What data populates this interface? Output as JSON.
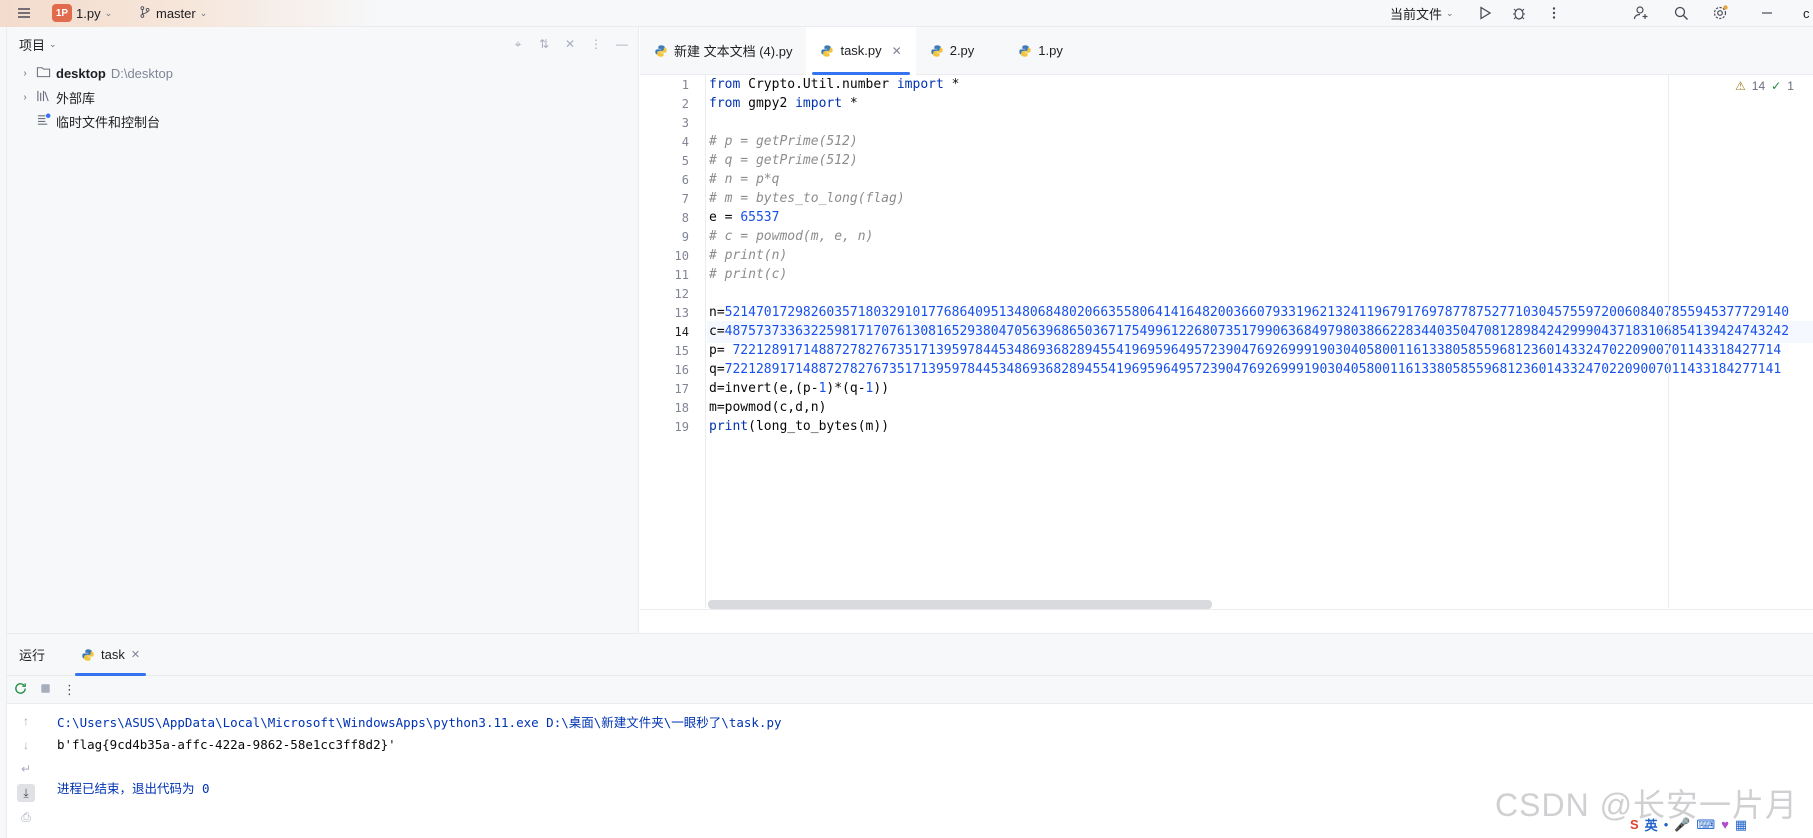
{
  "titlebar": {
    "project_badge": "1P",
    "project_name": "1.py",
    "branch": "master",
    "run_config": "当前文件",
    "overflow_label": "c"
  },
  "project_panel": {
    "title": "项目",
    "tree": [
      {
        "label": "desktop",
        "path": "D:\\desktop"
      },
      {
        "label": "外部库"
      },
      {
        "label": "临时文件和控制台"
      }
    ]
  },
  "editor": {
    "tabs": [
      {
        "label": "新建 文本文档 (4).py",
        "active": false
      },
      {
        "label": "task.py",
        "active": true
      },
      {
        "label": "2.py",
        "active": false
      },
      {
        "label": "1.py",
        "active": false
      }
    ],
    "inspections": {
      "warnings": "14",
      "checks": "1"
    },
    "current_line": 14,
    "line_numbers": [
      "1",
      "2",
      "3",
      "4",
      "5",
      "6",
      "7",
      "8",
      "9",
      "10",
      "11",
      "12",
      "13",
      "14",
      "15",
      "16",
      "17",
      "18",
      "19"
    ],
    "lines": [
      {
        "k1": "from",
        "t1": " Crypto.Util.number ",
        "k2": "import",
        "t2": " *"
      },
      {
        "k1": "from",
        "t1": " gmpy2 ",
        "k2": "import",
        "t2": " *"
      },
      {
        "t": ""
      },
      {
        "c": "# p = getPrime(512)"
      },
      {
        "c": "# q = getPrime(512)"
      },
      {
        "c": "# n = p*q"
      },
      {
        "c": "# m = bytes_to_long(flag)"
      },
      {
        "t": "e = ",
        "n": "65537"
      },
      {
        "c": "# c = powmod(m, e, n)"
      },
      {
        "c": "# print(n)"
      },
      {
        "c": "# print(c)"
      },
      {
        "t": ""
      },
      {
        "t": "n=",
        "n": "5214701729826035718032910177686409513480684802066355806414164820036607933196213241196791769787787527710304575597200608407855945377729140"
      },
      {
        "t": "c=",
        "n": "4875737336322598171707613081652938047056396865036717549961226807351799063684979803866228344035047081289842429990437183106854139424743242"
      },
      {
        "t": "p= ",
        "n": "72212891714887278276735171395978445348693682894554196959649572390476926999190304058001161338058559681236014332470220900701143318427714"
      },
      {
        "t": "q=",
        "n": "722128917148872782767351713959784453486936828945541969596495723904769269991903040580011613380585596812360143324702209007011433184277141"
      },
      {
        "t": "d=invert(e,(p-",
        "n": "1",
        "t2": ")*(q-",
        "n2": "1",
        "t3": "))"
      },
      {
        "t": "m=powmod(c,d,n)"
      },
      {
        "k1": "print",
        "t1": "(long_to_bytes(m))"
      }
    ]
  },
  "run_panel": {
    "label": "运行",
    "tab": "task",
    "console": [
      "C:\\Users\\ASUS\\AppData\\Local\\Microsoft\\WindowsApps\\python3.11.exe D:\\桌面\\新建文件夹\\一眼秒了\\task.py",
      "b'flag{9cd4b35a-affc-422a-9862-58e1cc3ff8d2}'",
      "",
      "进程已结束，退出代码为 0"
    ]
  },
  "watermark": "CSDN @长安一片月",
  "tray": {
    "ime": "英"
  }
}
